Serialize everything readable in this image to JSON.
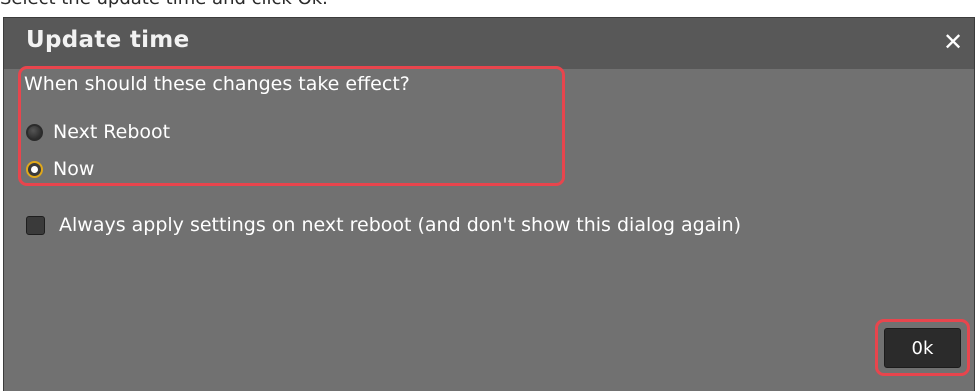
{
  "page": {
    "caption": "Select the update time and click Ok."
  },
  "dialog": {
    "title": "Update time",
    "close_symbol": "✕",
    "question": "When should these changes take effect?",
    "options": [
      {
        "label": "Next Reboot",
        "selected": false
      },
      {
        "label": "Now",
        "selected": true
      }
    ],
    "checkbox": {
      "label": "Always apply settings on next reboot (and don't show this dialog again)",
      "checked": false
    },
    "ok_label": "0k"
  },
  "colors": {
    "dialog_background": "#717171",
    "titlebar_background": "#585858",
    "highlight": "#e8454d",
    "radio_selected_ring": "#e0a81a",
    "button_background": "#2b2b2b"
  }
}
